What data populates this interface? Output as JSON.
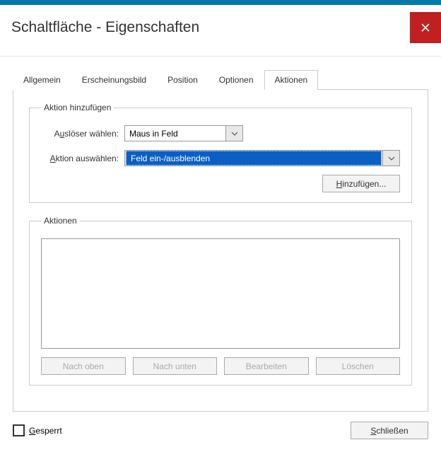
{
  "header": {
    "title": "Schaltfläche - Eigenschaften"
  },
  "tabs": {
    "items": [
      "Allgemein",
      "Erscheinungsbild",
      "Position",
      "Optionen",
      "Aktionen"
    ],
    "active": 4
  },
  "addAction": {
    "legend": "Aktion hinzufügen",
    "triggerLabelPre": "A",
    "triggerLabelU": "u",
    "triggerLabelPost": "slöser wählen:",
    "triggerValue": "Maus in Feld",
    "actionLabelU": "A",
    "actionLabelPost": "ktion auswählen:",
    "actionValue": "Feld ein-/ausblenden",
    "addBtnU": "H",
    "addBtnPost": "inzufügen..."
  },
  "actions": {
    "legend": "Aktionen",
    "up": "Nach oben",
    "down": "Nach unten",
    "edit": "Bearbeiten",
    "del": "Löschen"
  },
  "footer": {
    "lockedU": "G",
    "lockedPost": "esperrt",
    "closeU": "S",
    "closePost": "chließen"
  }
}
